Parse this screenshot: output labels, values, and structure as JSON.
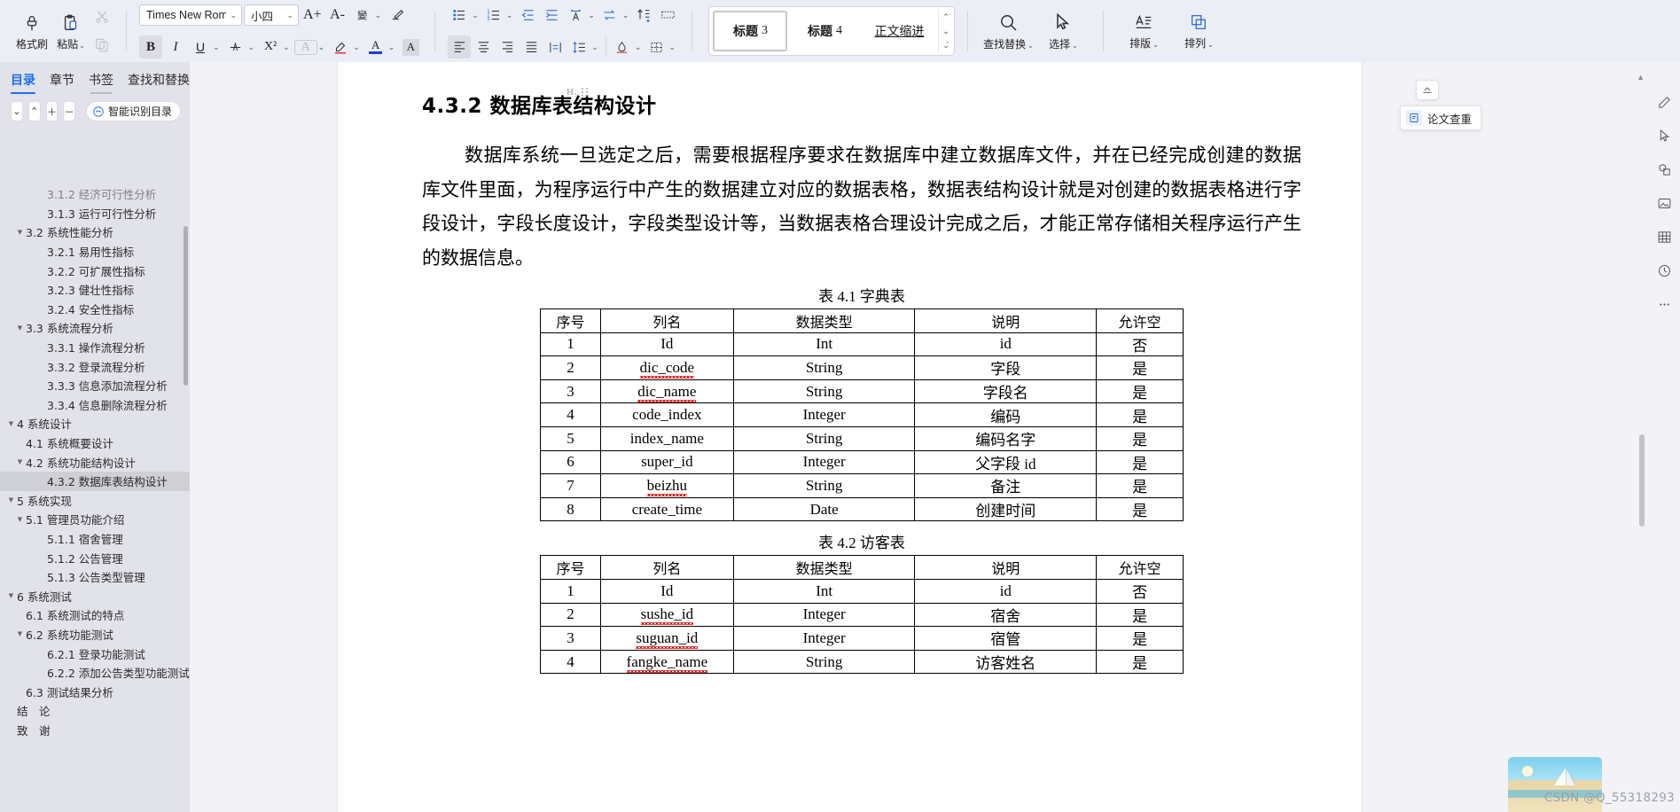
{
  "ribbon": {
    "clipboard": [
      {
        "label": "格式刷",
        "icon": "format-painter-icon",
        "caret": false
      },
      {
        "label": "粘贴",
        "icon": "paste-icon",
        "caret": true
      }
    ],
    "clipboard_mini": [
      {
        "icon": "cut-scissors-icon",
        "dim": true
      },
      {
        "icon": "copy-icon",
        "dim": true
      }
    ],
    "font": {
      "name": "Times New Roma",
      "size": "小四",
      "grow_label": "A+",
      "shrink_label": "A-",
      "phonetic_label": "wén",
      "clear_format_icon": "clear-formatting-icon",
      "bold": "B",
      "italic": "I",
      "underline": "U",
      "strikethrough_icon": "strikethrough-icon",
      "superscript": "X²",
      "char_border_icon": "char-border-icon",
      "highlight_icon": "text-highlight-icon",
      "font_color": "A",
      "font_color_swatch": "#1a3fd0",
      "char_shading_icon": "char-shading-icon"
    },
    "paragraph": {
      "bullets_icon": "bullet-list-icon",
      "numbering_icon": "numbered-list-icon",
      "decrease_indent_icon": "decrease-indent-icon",
      "increase_indent_icon": "increase-indent-icon",
      "pinyin_icon": "pinyin-guide-icon",
      "sort_asc_icon": "sort-icon",
      "show_marks_icon": "show-paragraph-marks-icon",
      "grid_icon": "grid-icon",
      "align_left_icon": "align-left-icon",
      "align_center_icon": "align-center-icon",
      "align_right_icon": "align-right-icon",
      "align_justify_icon": "align-justify-icon",
      "distribute_icon": "distribute-text-icon",
      "line_spacing_icon": "line-spacing-icon",
      "shading_icon": "paragraph-shading-icon",
      "borders_icon": "borders-icon"
    },
    "styles": [
      {
        "label": "标题",
        "num": "3",
        "selected": true,
        "bold": true
      },
      {
        "label": "标题",
        "num": "4",
        "selected": false,
        "bold": true
      },
      {
        "label": "正文缩进",
        "num": "",
        "selected": false,
        "bold": false
      }
    ],
    "tools": [
      {
        "label": "查找替换",
        "icon": "search-icon",
        "caret": true
      },
      {
        "label": "选择",
        "icon": "cursor-select-icon",
        "caret": true
      },
      {
        "label": "排版",
        "icon": "typeset-icon",
        "caret": true
      },
      {
        "label": "排列",
        "icon": "arrange-icon",
        "caret": true
      }
    ]
  },
  "navpanel": {
    "tabs": [
      {
        "label": "目录",
        "state": "active"
      },
      {
        "label": "章节",
        "state": "normal"
      },
      {
        "label": "书签",
        "state": "underlined"
      },
      {
        "label": "查找和替换",
        "state": "normal"
      }
    ],
    "close_label": "✕",
    "toolbar": {
      "collapse_down": "⌄",
      "collapse_up": "⌃",
      "expand_plus": "＋",
      "collapse_minus": "－",
      "smart_toc_label": "智能识别目录"
    },
    "toc": [
      {
        "label": "3.1.2  经济可行性分析",
        "level": 3,
        "arrow": "",
        "selected": false,
        "clipped": true
      },
      {
        "label": "3.1.3  运行可行性分析",
        "level": 3,
        "arrow": "",
        "selected": false
      },
      {
        "label": "3.2  系统性能分析",
        "level": 2,
        "arrow": "▼",
        "selected": false
      },
      {
        "label": "3.2.1  易用性指标",
        "level": 3,
        "arrow": "",
        "selected": false
      },
      {
        "label": "3.2.2  可扩展性指标",
        "level": 3,
        "arrow": "",
        "selected": false
      },
      {
        "label": "3.2.3  健壮性指标",
        "level": 3,
        "arrow": "",
        "selected": false
      },
      {
        "label": "3.2.4  安全性指标",
        "level": 3,
        "arrow": "",
        "selected": false
      },
      {
        "label": "3.3  系统流程分析",
        "level": 2,
        "arrow": "▼",
        "selected": false
      },
      {
        "label": "3.3.1  操作流程分析",
        "level": 3,
        "arrow": "",
        "selected": false
      },
      {
        "label": "3.3.2  登录流程分析",
        "level": 3,
        "arrow": "",
        "selected": false
      },
      {
        "label": "3.3.3  信息添加流程分析",
        "level": 3,
        "arrow": "",
        "selected": false
      },
      {
        "label": "3.3.4  信息删除流程分析",
        "level": 3,
        "arrow": "",
        "selected": false
      },
      {
        "label": "4  系统设计",
        "level": 1,
        "arrow": "▼",
        "selected": false
      },
      {
        "label": "4.1  系统概要设计",
        "level": 2,
        "arrow": "",
        "selected": false
      },
      {
        "label": "4.2  系统功能结构设计",
        "level": 2,
        "arrow": "▼",
        "selected": false
      },
      {
        "label": "4.3.2  数据库表结构设计",
        "level": 3,
        "arrow": "",
        "selected": true
      },
      {
        "label": "5  系统实现",
        "level": 1,
        "arrow": "▼",
        "selected": false
      },
      {
        "label": "5.1  管理员功能介绍",
        "level": 2,
        "arrow": "▼",
        "selected": false
      },
      {
        "label": "5.1.1  宿舍管理",
        "level": 3,
        "arrow": "",
        "selected": false
      },
      {
        "label": "5.1.2  公告管理",
        "level": 3,
        "arrow": "",
        "selected": false
      },
      {
        "label": "5.1.3  公告类型管理",
        "level": 3,
        "arrow": "",
        "selected": false
      },
      {
        "label": "6  系统测试",
        "level": 1,
        "arrow": "▼",
        "selected": false
      },
      {
        "label": "6.1  系统测试的特点",
        "level": 2,
        "arrow": "",
        "selected": false
      },
      {
        "label": "6.2  系统功能测试",
        "level": 2,
        "arrow": "▼",
        "selected": false
      },
      {
        "label": "6.2.1  登录功能测试",
        "level": 3,
        "arrow": "",
        "selected": false
      },
      {
        "label": "6.2.2  添加公告类型功能测试",
        "level": 3,
        "arrow": "",
        "selected": false
      },
      {
        "label": "6.3  测试结果分析",
        "level": 2,
        "arrow": "",
        "selected": false
      },
      {
        "label": "结　论",
        "level": 1,
        "arrow": "",
        "selected": false
      },
      {
        "label": "致　谢",
        "level": 1,
        "arrow": "",
        "selected": false
      }
    ]
  },
  "document": {
    "heading_marker": "H₃",
    "heading": "4.3.2  数据库表结构设计",
    "paragraph": "数据库系统一旦选定之后，需要根据程序要求在数据库中建立数据库文件，并在已经完成创建的数据库文件里面，为程序运行中产生的数据建立对应的数据表格，数据表结构设计就是对创建的数据表格进行字段设计，字段长度设计，字段类型设计等，当数据表格合理设计完成之后，才能正常存储相关程序运行产生的数据信息。",
    "table1": {
      "caption": "表 4.1 字典表",
      "headers": [
        "序号",
        "列名",
        "数据类型",
        "说明",
        "允许空"
      ],
      "rows": [
        [
          "1",
          "Id",
          "Int",
          "id",
          "否"
        ],
        [
          "2",
          "dic_code",
          "String",
          "字段",
          "是"
        ],
        [
          "3",
          "dic_name",
          "String",
          "字段名",
          "是"
        ],
        [
          "4",
          "code_index",
          "Integer",
          "编码",
          "是"
        ],
        [
          "5",
          "index_name",
          "String",
          "编码名字",
          "是"
        ],
        [
          "6",
          "super_id",
          "Integer",
          "父字段 id",
          "是"
        ],
        [
          "7",
          "beizhu",
          "String",
          "备注",
          "是"
        ],
        [
          "8",
          "create_time",
          "Date",
          "创建时间",
          "是"
        ]
      ],
      "misspelled": [
        "dic_code",
        "dic_name",
        "beizhu"
      ]
    },
    "table2": {
      "caption": "表 4.2 访客表",
      "headers": [
        "序号",
        "列名",
        "数据类型",
        "说明",
        "允许空"
      ],
      "rows": [
        [
          "1",
          "Id",
          "Int",
          "id",
          "否"
        ],
        [
          "2",
          "sushe_id",
          "Integer",
          "宿舍",
          "是"
        ],
        [
          "3",
          "suguan_id",
          "Integer",
          "宿管",
          "是"
        ],
        [
          "4",
          "fangke_name",
          "String",
          "访客姓名",
          "是"
        ]
      ],
      "misspelled": [
        "sushe_id",
        "suguan_id",
        "fangke_name"
      ]
    }
  },
  "floating": {
    "home_icon": "home-icon",
    "chip_icon": "paper-check-icon",
    "chip_label": "论文查重"
  },
  "right_toolbar": [
    {
      "icon": "pen-tool-icon"
    },
    {
      "icon": "cursor-arrow-icon"
    },
    {
      "icon": "shapes-icon"
    },
    {
      "icon": "picture-icon"
    },
    {
      "icon": "table-icon"
    },
    {
      "icon": "clock-icon"
    },
    {
      "icon": "more-dots-icon"
    }
  ],
  "watermark": "CSDN @Q_55318293"
}
